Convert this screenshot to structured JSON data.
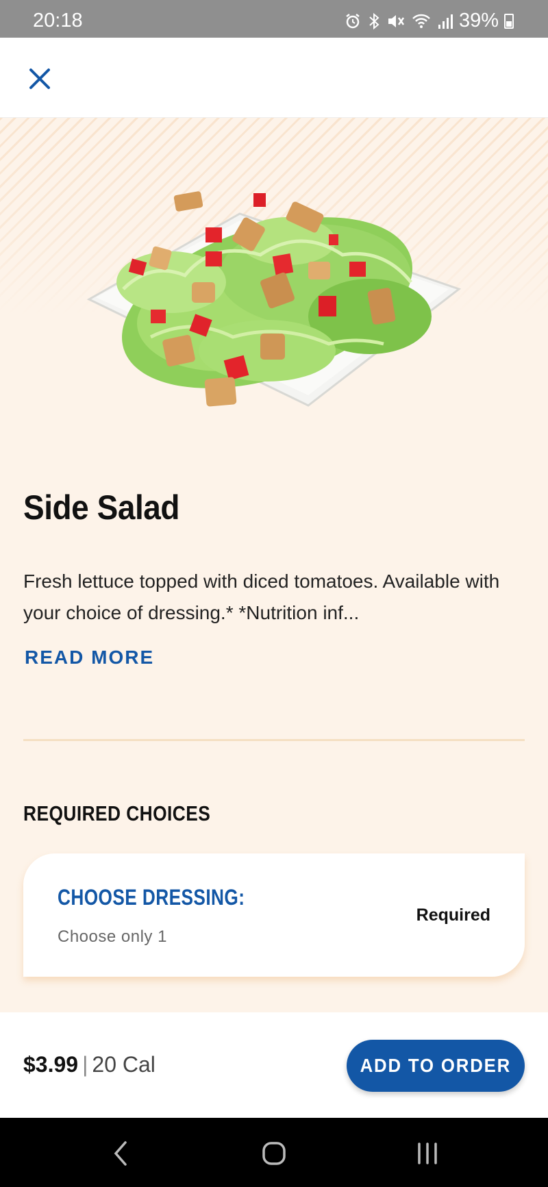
{
  "status_bar": {
    "time": "20:18",
    "battery": "39%",
    "icons": [
      "alarm-icon",
      "bluetooth-icon",
      "mute-icon",
      "wifi-icon",
      "signal-icon",
      "battery-icon"
    ]
  },
  "top_bar": {
    "close_icon": "close-icon"
  },
  "product": {
    "image": "salad-image",
    "title": "Side Salad",
    "description": "Fresh lettuce topped with diced tomatoes. Available with your choice of dressing.* *Nutrition inf...",
    "read_more_label": "READ MORE"
  },
  "required": {
    "heading": "REQUIRED CHOICES",
    "choices": [
      {
        "title": "CHOOSE DRESSING:",
        "subtitle": "Choose only 1",
        "status": "Required"
      }
    ]
  },
  "order_bar": {
    "price": "$3.99",
    "separator": "|",
    "calories": "20 Cal",
    "add_label": "ADD TO ORDER"
  },
  "nav_bar": {
    "icons": [
      "back-icon",
      "home-icon",
      "recents-icon"
    ]
  },
  "colors": {
    "accent": "#1357a6",
    "background": "#fdf3e9",
    "status_bar": "#8f8f8f"
  }
}
